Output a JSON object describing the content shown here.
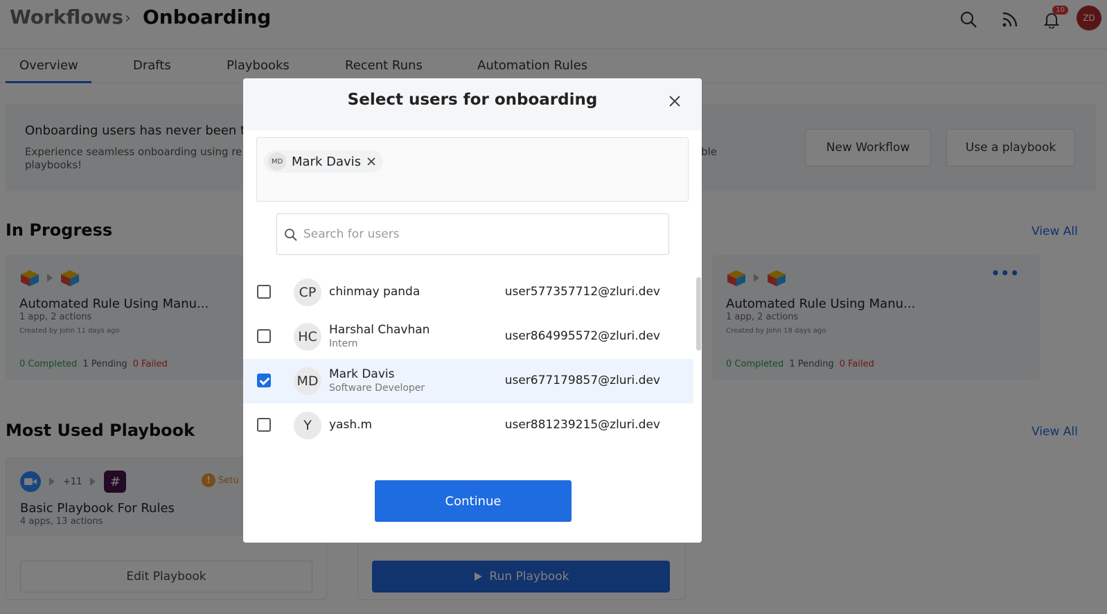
{
  "header": {
    "breadcrumb_root": "Workflows",
    "breadcrumb_sep": "›",
    "breadcrumb_current": "Onboarding",
    "notification_count": "10",
    "user_initials": "ZD"
  },
  "tabs": [
    "Overview",
    "Drafts",
    "Playbooks",
    "Recent Runs",
    "Automation Rules"
  ],
  "banner": {
    "title": "Onboarding users has never been th",
    "subtitle": "Experience seamless onboarding using re playbooks!",
    "subtitle_tail": "ble",
    "new_workflow": "New Workflow",
    "use_playbook": "Use a playbook"
  },
  "in_progress": {
    "title": "In Progress",
    "view_all": "View All",
    "cards": [
      {
        "title": "Automated Rule Using Manu...",
        "meta": "1 app, 2 actions",
        "created": "Created by John 11 days ago",
        "completed": "0 Completed",
        "pending": "1 Pending",
        "failed": "0 Failed"
      },
      {
        "title": "Automated Rule Using Manu...",
        "meta": "1 app, 2 actions",
        "created": "Created by John 18 days ago",
        "completed": "0 Completed",
        "pending": "1 Pending",
        "failed": "0 Failed"
      }
    ]
  },
  "most_used": {
    "title": "Most Used Playbook",
    "view_all": "View All",
    "card": {
      "title": "Basic Playbook For Rules",
      "meta": "4 apps, 13 actions",
      "more_apps": "+11",
      "setup": "Setu",
      "edit": "Edit Playbook"
    },
    "run": "Run Playbook"
  },
  "modal": {
    "title": "Select users for onboarding",
    "selected_chip": {
      "initials": "MD",
      "name": "Mark Davis"
    },
    "search_placeholder": "Search for users",
    "users": [
      {
        "initials": "CP",
        "name": "chinmay panda",
        "role": "",
        "email": "user577357712@zluri.dev",
        "checked": false
      },
      {
        "initials": "HC",
        "name": "Harshal Chavhan",
        "role": "Intern",
        "email": "user864995572@zluri.dev",
        "checked": false
      },
      {
        "initials": "MD",
        "name": "Mark Davis",
        "role": "Software Developer",
        "email": "user677179857@zluri.dev",
        "checked": true
      },
      {
        "initials": "Y",
        "name": "yash.m",
        "role": "",
        "email": "user881239215@zluri.dev",
        "checked": false
      }
    ],
    "continue_label": "Continue"
  },
  "colors": {
    "accent": "#2266dd",
    "success": "#2a9d48",
    "danger": "#d33333"
  }
}
